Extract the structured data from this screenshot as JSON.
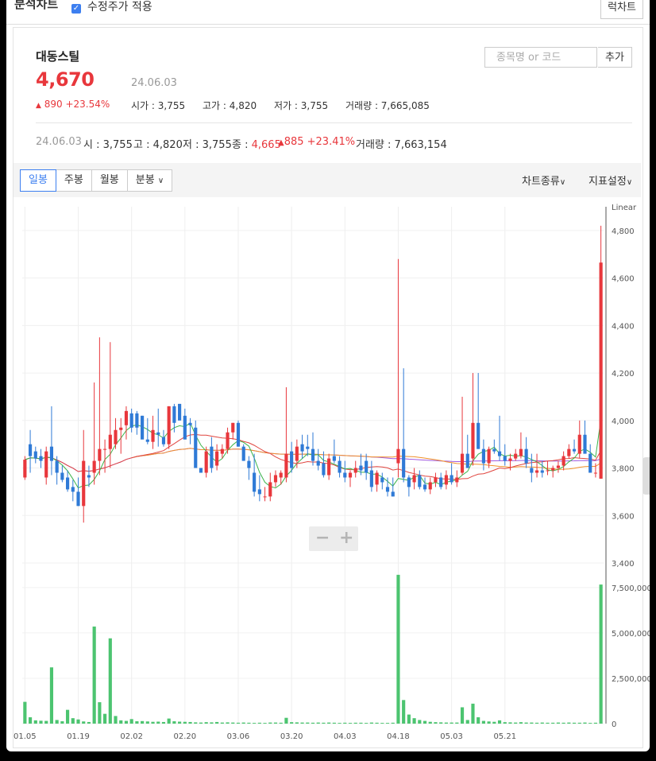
{
  "topbar": {
    "title": "분석차트",
    "checkbox_label": "수정주가 적용",
    "right_button": "럭차트"
  },
  "stock": {
    "name": "대동스틸",
    "price": "4,670",
    "date": "24.06.03",
    "change": "890 +23.54%",
    "open_label": "시가",
    "open": "3,755",
    "high_label": "고가",
    "high": "4,820",
    "low_label": "저가",
    "low": "3,755",
    "volume_label": "거래량",
    "volume": "7,665,085"
  },
  "search": {
    "placeholder": "종목명 or 코드",
    "add_label": "추가"
  },
  "detail": {
    "date": "24.06.03",
    "open_label": "시",
    "open": "3,755",
    "high_label": "고",
    "high": "4,820",
    "low_label": "저",
    "low": "3,755",
    "close_label": "종",
    "close": "4,665",
    "change": "885 +23.41%",
    "volume_label": "거래량",
    "volume": "7,663,154"
  },
  "toolbar": {
    "tabs": [
      "일봉",
      "주봉",
      "월봉",
      "분봉"
    ],
    "chart_type": "차트종류",
    "indicator": "지표설정"
  },
  "colors": {
    "up": "#e8373c",
    "down": "#2f7ad6",
    "ma5": "#3cb44b",
    "ma20": "#e0453f",
    "ma60": "#f0902a",
    "ma120": "#a05ae0",
    "volume": "#4cc470"
  },
  "chart_data": {
    "type": "candlestick",
    "scale_label": "Linear",
    "x_tick_labels": [
      "01.05",
      "01.19",
      "02.02",
      "02.20",
      "03.06",
      "03.20",
      "04.03",
      "04.18",
      "05.03",
      "05.21"
    ],
    "x_tick_indices": [
      0,
      10,
      20,
      30,
      40,
      50,
      60,
      70,
      80,
      90
    ],
    "ylim": [
      3400,
      4900
    ],
    "y_ticks": [
      3400,
      3600,
      3800,
      4000,
      4200,
      4400,
      4600,
      4800
    ],
    "y_tick_labels": [
      "3,400",
      "3,600",
      "3,800",
      "4,000",
      "4,200",
      "4,400",
      "4,600",
      "4,800"
    ],
    "volume_ylim": [
      0,
      8500000
    ],
    "volume_ticks": [
      0,
      2500000,
      5000000,
      7500000
    ],
    "volume_tick_labels": [
      "0",
      "2,500,000",
      "5,000,000",
      "7,500,000"
    ],
    "ohlc": [
      [
        3760,
        3850,
        3750,
        3835
      ],
      [
        3900,
        3960,
        3780,
        3850
      ],
      [
        3870,
        3890,
        3820,
        3840
      ],
      [
        3850,
        3880,
        3800,
        3830
      ],
      [
        3760,
        3890,
        3730,
        3870
      ],
      [
        3890,
        4060,
        3770,
        3830
      ],
      [
        3830,
        3850,
        3730,
        3780
      ],
      [
        3780,
        3810,
        3740,
        3750
      ],
      [
        3760,
        3790,
        3700,
        3710
      ],
      [
        3720,
        3750,
        3660,
        3700
      ],
      [
        3700,
        3760,
        3640,
        3640
      ],
      [
        3640,
        3960,
        3570,
        3830
      ],
      [
        3770,
        3810,
        3720,
        3760
      ],
      [
        3780,
        4160,
        3730,
        3830
      ],
      [
        3830,
        4350,
        3770,
        3880
      ],
      [
        3880,
        3920,
        3780,
        3880
      ],
      [
        3880,
        4330,
        3800,
        3940
      ],
      [
        3900,
        4010,
        3880,
        3960
      ],
      [
        3960,
        4010,
        3860,
        3970
      ],
      [
        3980,
        4060,
        3920,
        4040
      ],
      [
        4030,
        4050,
        3950,
        3970
      ],
      [
        4030,
        4040,
        3940,
        3970
      ],
      [
        4020,
        4020,
        3930,
        3920
      ],
      [
        3920,
        4010,
        3900,
        3910
      ],
      [
        3910,
        4020,
        3880,
        3960
      ],
      [
        3950,
        4050,
        3890,
        3940
      ],
      [
        3930,
        3960,
        3890,
        3900
      ],
      [
        3900,
        4060,
        3880,
        4060
      ],
      [
        4060,
        4070,
        3950,
        3990
      ],
      [
        4070,
        4070,
        4020,
        4000
      ],
      [
        4020,
        4050,
        3940,
        3920
      ],
      [
        3990,
        4010,
        3900,
        3980
      ],
      [
        3970,
        4000,
        3850,
        3800
      ],
      [
        3800,
        3800,
        3780,
        3780
      ],
      [
        3780,
        3890,
        3760,
        3870
      ],
      [
        3890,
        3930,
        3780,
        3800
      ],
      [
        3810,
        3900,
        3790,
        3870
      ],
      [
        3860,
        3900,
        3840,
        3880
      ],
      [
        3880,
        3970,
        3860,
        3950
      ],
      [
        3950,
        3990,
        3920,
        3990
      ],
      [
        3990,
        4000,
        3890,
        3890
      ],
      [
        3890,
        3900,
        3830,
        3830
      ],
      [
        3830,
        3850,
        3750,
        3800
      ],
      [
        3780,
        3860,
        3680,
        3700
      ],
      [
        3710,
        3770,
        3660,
        3690
      ],
      [
        3680,
        3720,
        3660,
        3680
      ],
      [
        3680,
        3780,
        3660,
        3740
      ],
      [
        3740,
        3790,
        3720,
        3770
      ],
      [
        3760,
        3790,
        3730,
        3780
      ],
      [
        3760,
        4140,
        3740,
        3860
      ],
      [
        3870,
        3910,
        3780,
        3800
      ],
      [
        3830,
        3920,
        3800,
        3890
      ],
      [
        3900,
        3940,
        3840,
        3870
      ],
      [
        3890,
        3940,
        3850,
        3880
      ],
      [
        3880,
        3950,
        3810,
        3830
      ],
      [
        3830,
        3880,
        3790,
        3810
      ],
      [
        3820,
        3870,
        3760,
        3770
      ],
      [
        3770,
        3860,
        3750,
        3840
      ],
      [
        3850,
        3920,
        3820,
        3830
      ],
      [
        3830,
        3850,
        3760,
        3780
      ],
      [
        3780,
        3830,
        3740,
        3760
      ],
      [
        3760,
        3790,
        3720,
        3780
      ],
      [
        3780,
        3830,
        3760,
        3800
      ],
      [
        3810,
        3860,
        3770,
        3790
      ],
      [
        3830,
        3860,
        3750,
        3780
      ],
      [
        3790,
        3830,
        3700,
        3720
      ],
      [
        3730,
        3790,
        3700,
        3780
      ],
      [
        3760,
        3780,
        3710,
        3740
      ],
      [
        3720,
        3760,
        3680,
        3700
      ],
      [
        3700,
        3760,
        3680,
        3680
      ],
      [
        3820,
        4680,
        3760,
        3880
      ],
      [
        3880,
        4220,
        3740,
        3760
      ],
      [
        3760,
        3770,
        3680,
        3720
      ],
      [
        3740,
        3800,
        3710,
        3770
      ],
      [
        3770,
        3790,
        3710,
        3720
      ],
      [
        3730,
        3760,
        3700,
        3710
      ],
      [
        3710,
        3760,
        3690,
        3740
      ],
      [
        3740,
        3780,
        3720,
        3760
      ],
      [
        3760,
        3780,
        3710,
        3720
      ],
      [
        3730,
        3790,
        3710,
        3770
      ],
      [
        3770,
        3820,
        3730,
        3740
      ],
      [
        3740,
        3790,
        3720,
        3760
      ],
      [
        3780,
        4100,
        3770,
        3860
      ],
      [
        3860,
        3940,
        3800,
        3800
      ],
      [
        3840,
        4200,
        3810,
        3990
      ],
      [
        3990,
        4200,
        3880,
        3880
      ],
      [
        3880,
        3920,
        3790,
        3820
      ],
      [
        3820,
        3890,
        3800,
        3880
      ],
      [
        3880,
        3920,
        3860,
        3870
      ],
      [
        3870,
        4020,
        3830,
        3850
      ],
      [
        3850,
        3900,
        3810,
        3830
      ],
      [
        3830,
        3860,
        3790,
        3840
      ],
      [
        3840,
        3880,
        3830,
        3860
      ],
      [
        3850,
        3950,
        3840,
        3880
      ],
      [
        3880,
        3930,
        3800,
        3820
      ],
      [
        3800,
        3860,
        3740,
        3780
      ],
      [
        3780,
        3860,
        3760,
        3790
      ],
      [
        3790,
        3830,
        3760,
        3780
      ],
      [
        3790,
        3830,
        3770,
        3790
      ],
      [
        3790,
        3810,
        3760,
        3800
      ],
      [
        3800,
        3830,
        3780,
        3810
      ],
      [
        3810,
        3870,
        3790,
        3850
      ],
      [
        3850,
        3900,
        3840,
        3880
      ],
      [
        3880,
        3920,
        3860,
        3870
      ],
      [
        3860,
        4000,
        3840,
        3940
      ],
      [
        3940,
        4000,
        3880,
        3860
      ],
      [
        3860,
        3900,
        3800,
        3780
      ],
      [
        3780,
        3820,
        3760,
        3780
      ],
      [
        3755,
        4820,
        3755,
        4665
      ]
    ],
    "volume": [
      1200000,
      350000,
      180000,
      160000,
      150000,
      3100000,
      200000,
      130000,
      760000,
      300000,
      230000,
      120000,
      90000,
      5350000,
      1180000,
      540000,
      4700000,
      420000,
      180000,
      150000,
      250000,
      130000,
      140000,
      120000,
      100000,
      110000,
      90000,
      280000,
      130000,
      110000,
      100000,
      90000,
      70000,
      60000,
      80000,
      70000,
      90000,
      60000,
      70000,
      60000,
      50000,
      60000,
      50000,
      40000,
      50000,
      40000,
      60000,
      60000,
      50000,
      320000,
      80000,
      70000,
      60000,
      60000,
      50000,
      60000,
      50000,
      60000,
      50000,
      40000,
      50000,
      40000,
      50000,
      50000,
      40000,
      60000,
      50000,
      40000,
      40000,
      50000,
      8200000,
      1300000,
      500000,
      300000,
      200000,
      150000,
      100000,
      80000,
      70000,
      60000,
      60000,
      60000,
      900000,
      200000,
      1100000,
      350000,
      150000,
      120000,
      100000,
      180000,
      80000,
      70000,
      60000,
      80000,
      60000,
      60000,
      50000,
      60000,
      50000,
      50000,
      60000,
      50000,
      60000,
      50000,
      50000,
      60000,
      40000,
      50000,
      7663154
    ]
  }
}
